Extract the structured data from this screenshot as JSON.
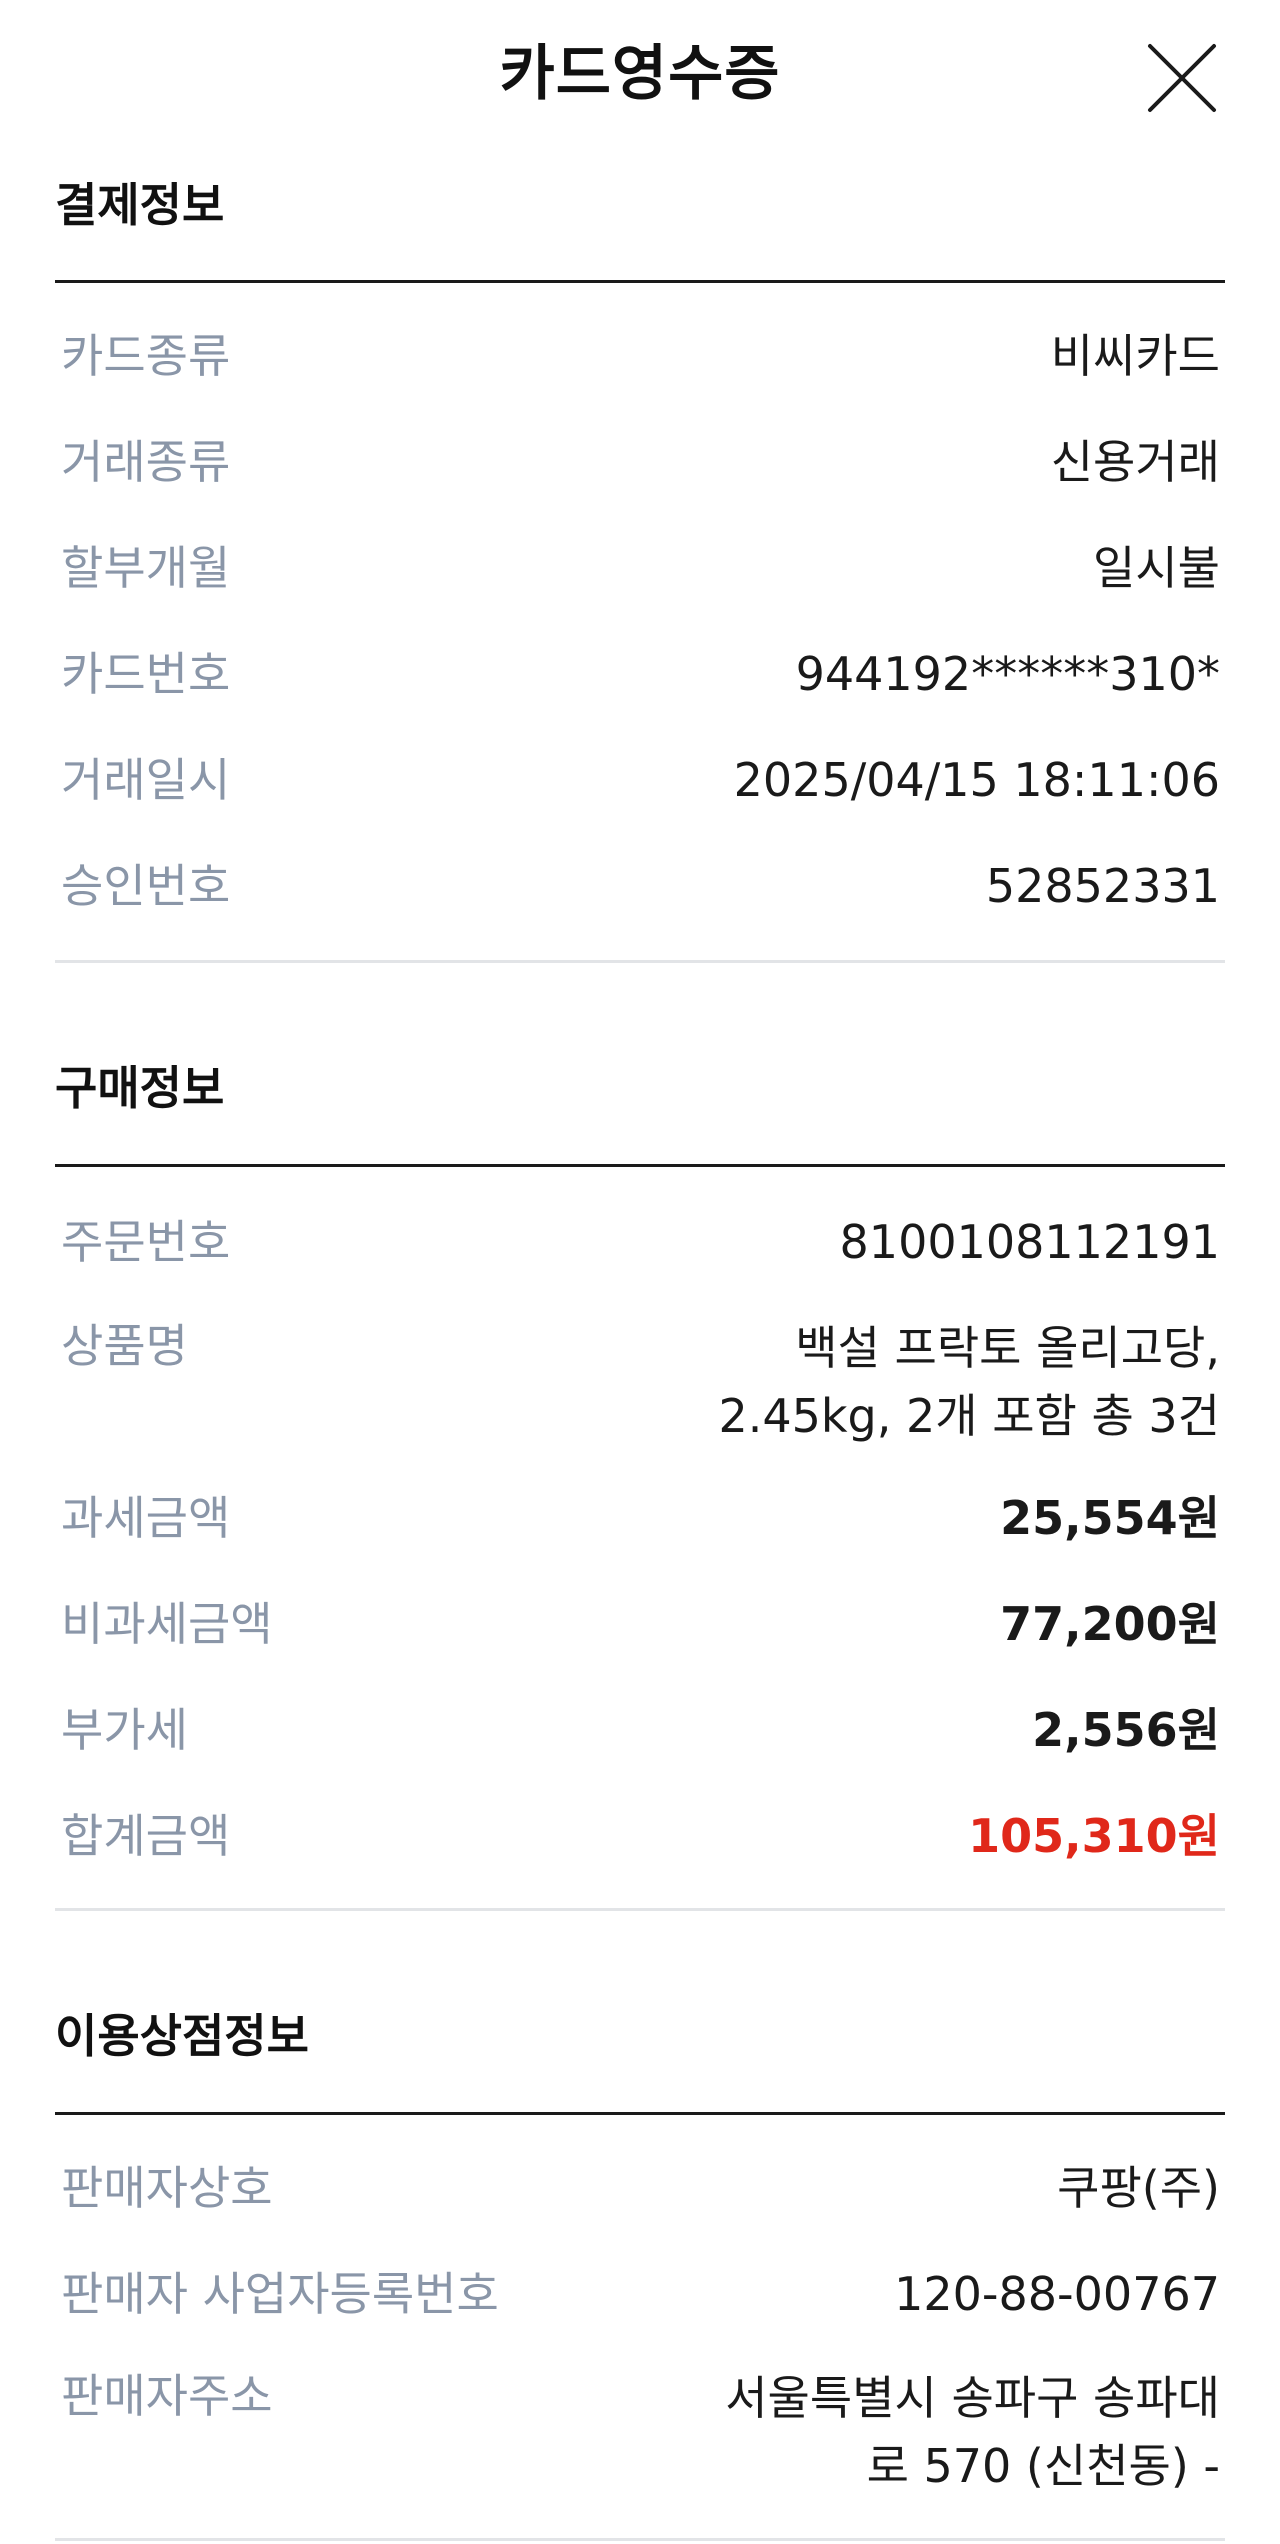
{
  "header": {
    "title": "카드영수증",
    "close_icon": "close-icon"
  },
  "colors": {
    "label": "#8a96a8",
    "value": "#1a1a1a",
    "total": "#e0281a",
    "divider_dark": "#1a1a1a",
    "divider_light": "#e2e4e7"
  },
  "payment": {
    "title": "결제정보",
    "rows": [
      {
        "label": "카드종류",
        "value": "비씨카드"
      },
      {
        "label": "거래종류",
        "value": "신용거래"
      },
      {
        "label": "할부개월",
        "value": "일시불"
      },
      {
        "label": "카드번호",
        "value": "944192******310*"
      },
      {
        "label": "거래일시",
        "value": "2025/04/15 18:11:06"
      },
      {
        "label": "승인번호",
        "value": "52852331"
      }
    ]
  },
  "purchase": {
    "title": "구매정보",
    "order_no": {
      "label": "주문번호",
      "value": "8100108112191"
    },
    "product": {
      "label": "상품명",
      "value_line1": "백설 프락토 올리고당,",
      "value_line2": "2.45kg, 2개 포함 총 3건"
    },
    "taxable": {
      "label": "과세금액",
      "value": "25,554원"
    },
    "tax_free": {
      "label": "비과세금액",
      "value": "77,200원"
    },
    "vat": {
      "label": "부가세",
      "value": "2,556원"
    },
    "total": {
      "label": "합계금액",
      "value": "105,310원"
    }
  },
  "merchant": {
    "title": "이용상점정보",
    "seller_name": {
      "label": "판매자상호",
      "value": "쿠팡(주)"
    },
    "business_no": {
      "label": "판매자 사업자등록번호",
      "value": "120-88-00767"
    },
    "address": {
      "label": "판매자주소",
      "value_line1": "서울특별시 송파구 송파대",
      "value_line2": "로 570 (신천동) -"
    }
  }
}
